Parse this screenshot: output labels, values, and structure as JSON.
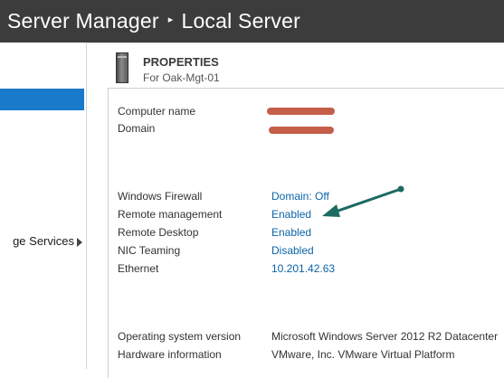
{
  "title_bar": {
    "app": "Server Manager",
    "separator_glyph": "▸",
    "page": "Local Server"
  },
  "sidebar": {
    "item_label": "ge Services"
  },
  "properties": {
    "heading": "PROPERTIES",
    "subheading": "For Oak-Mgt-01",
    "identity": [
      {
        "label": "Computer name",
        "value_redacted": true
      },
      {
        "label": "Domain",
        "value_redacted": true
      }
    ],
    "settings": [
      {
        "label": "Windows Firewall",
        "value": "Domain: Off"
      },
      {
        "label": "Remote management",
        "value": "Enabled"
      },
      {
        "label": "Remote Desktop",
        "value": "Enabled"
      },
      {
        "label": "NIC Teaming",
        "value": "Disabled"
      },
      {
        "label": "Ethernet",
        "value": "10.201.42.63"
      }
    ],
    "system": [
      {
        "label": "Operating system version",
        "value": "Microsoft Windows Server 2012 R2 Datacenter"
      },
      {
        "label": "Hardware information",
        "value": "VMware, Inc. VMware Virtual Platform"
      }
    ]
  },
  "colors": {
    "title_bar_bg": "#3c3c3c",
    "nav_selected": "#1979ca",
    "link": "#0b64a8",
    "redaction": "#c0503a",
    "annotation_arrow": "#1d6a63"
  },
  "icons": [
    "server-icon",
    "chevron-right-icon",
    "annotation-arrow-icon"
  ]
}
